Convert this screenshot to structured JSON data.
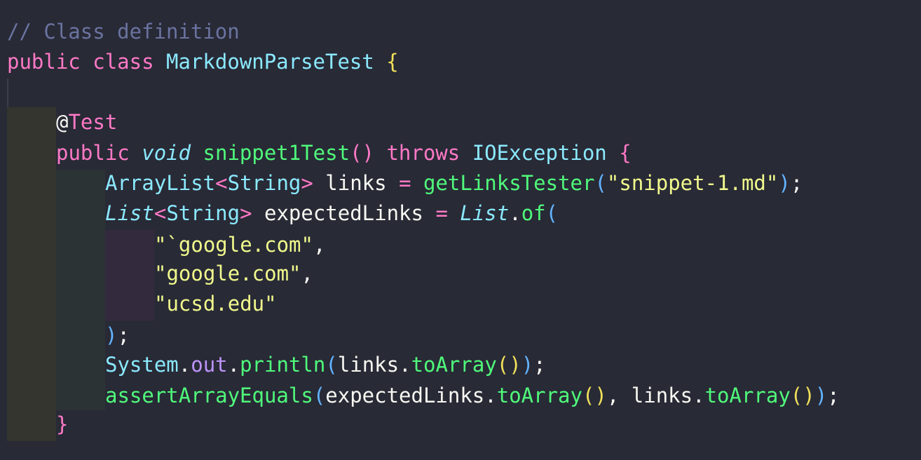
{
  "code": {
    "comment": "// Class definition",
    "class_decl": {
      "public": "public",
      "class": "class",
      "name": "MarkdownParseTest",
      "brace": "{"
    },
    "annotation": {
      "at": "@",
      "name": "Test"
    },
    "method_decl": {
      "public": "public",
      "void": "void",
      "name": "snippet1Test",
      "parens": "()",
      "throws": "throws",
      "exception": "IOException",
      "brace": "{"
    },
    "line_links": {
      "type": "ArrayList",
      "lt": "<",
      "generic": "String",
      "gt": ">",
      "var": " links ",
      "eq": "=",
      "sp": " ",
      "fn": "getLinksTester",
      "open": "(",
      "arg": "\"snippet-1.md\"",
      "close": ")",
      "semi": ";"
    },
    "line_expected": {
      "type": "List",
      "lt": "<",
      "generic": "String",
      "gt": ">",
      "var": " expectedLinks ",
      "eq": "=",
      "sp": " ",
      "type2": "List",
      "dot": ".",
      "fn": "of",
      "open": "("
    },
    "list_items": [
      {
        "str": "\"`google.com\"",
        "comma": ","
      },
      {
        "str": "\"google.com\"",
        "comma": ","
      },
      {
        "str": "\"ucsd.edu\"",
        "comma": ""
      }
    ],
    "line_close_list": {
      "paren": ")",
      "semi": ";"
    },
    "line_println": {
      "obj": "System",
      "dot1": ".",
      "field": "out",
      "dot2": ".",
      "fn": "println",
      "open": "(",
      "arg": "links",
      "dot3": ".",
      "fn2": "toArray",
      "inner": "()",
      "close": ")",
      "semi": ";"
    },
    "line_assert": {
      "fn": "assertArrayEquals",
      "open": "(",
      "arg1": "expectedLinks",
      "dot1": ".",
      "fn2": "toArray",
      "inner1": "()",
      "comma": ", ",
      "arg2": "links",
      "dot2": ".",
      "fn3": "toArray",
      "inner2": "()",
      "close": ")",
      "semi": ";"
    },
    "method_close": "}"
  },
  "colors": {
    "background": "#282a36",
    "keyword": "#ff79c6",
    "type": "#8be9fd",
    "function": "#50fa7b",
    "string": "#f1fa8c",
    "comment": "#6b73a0"
  }
}
